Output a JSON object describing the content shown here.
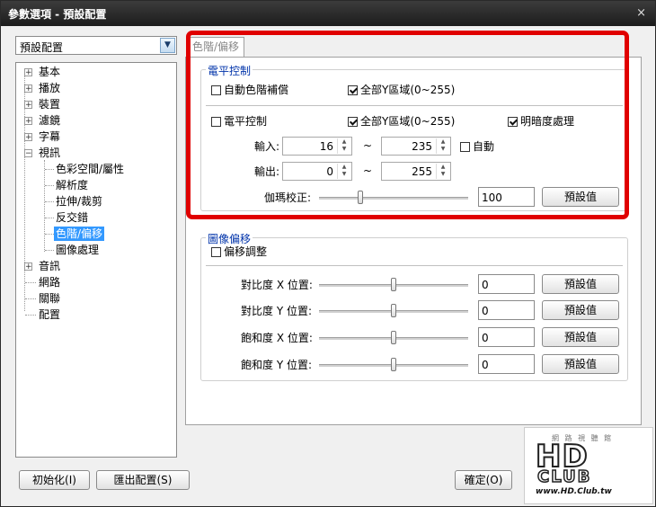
{
  "window": {
    "title": "參數選項 - 預設配置",
    "close_glyph": "×"
  },
  "profile_select": {
    "value": "預設配置"
  },
  "tree": {
    "items": [
      {
        "label": "基本",
        "expander": "+"
      },
      {
        "label": "播放",
        "expander": "+"
      },
      {
        "label": "裝置",
        "expander": "+"
      },
      {
        "label": "濾鏡",
        "expander": "+"
      },
      {
        "label": "字幕",
        "expander": "+"
      },
      {
        "label": "視訊",
        "expander": "−"
      },
      {
        "label": "色彩空間/屬性"
      },
      {
        "label": "解析度"
      },
      {
        "label": "拉伸/裁剪"
      },
      {
        "label": "反交錯"
      },
      {
        "label": "色階/偏移",
        "selected": true
      },
      {
        "label": "圖像處理"
      },
      {
        "label": "音訊",
        "expander": "+"
      },
      {
        "label": "網路"
      },
      {
        "label": "關聯"
      },
      {
        "label": "配置"
      }
    ]
  },
  "tab": {
    "label": "色階/偏移"
  },
  "level_group": {
    "title": "電平控制",
    "auto_level": {
      "label": "自動色階補償",
      "checked": false
    },
    "full_range_1": {
      "label": "全部Y區域(0~255)",
      "checked": true
    },
    "level_control": {
      "label": "電平控制",
      "checked": false
    },
    "full_range_2": {
      "label": "全部Y區域(0~255)",
      "checked": true
    },
    "brightness": {
      "label": "明暗度處理",
      "checked": true
    },
    "input": {
      "label": "輸入:",
      "low": "16",
      "high": "235",
      "tilde": "~"
    },
    "auto": {
      "label": "自動",
      "checked": false
    },
    "output": {
      "label": "輸出:",
      "low": "0",
      "high": "255",
      "tilde": "~"
    },
    "gamma": {
      "label": "伽瑪校正:",
      "value": "100",
      "slider_fraction": 0.27,
      "reset": "預設值"
    }
  },
  "offset_group": {
    "title": "圖像偏移",
    "offset_adjust": {
      "label": "偏移調整",
      "checked": false
    },
    "rows": [
      {
        "label": "對比度 X 位置:",
        "value": "0",
        "reset": "預設值",
        "slider_fraction": 0.5
      },
      {
        "label": "對比度 Y 位置:",
        "value": "0",
        "reset": "預設值",
        "slider_fraction": 0.5
      },
      {
        "label": "飽和度 X 位置:",
        "value": "0",
        "reset": "預設值",
        "slider_fraction": 0.5
      },
      {
        "label": "飽和度 Y 位置:",
        "value": "0",
        "reset": "預設值",
        "slider_fraction": 0.5
      }
    ]
  },
  "footer": {
    "init_button": "初始化(I)",
    "export_button": "匯出配置(S)",
    "ok_button": "確定(O)"
  },
  "watermark": {
    "tiny": "網 路 視 聽 館",
    "big": "HD",
    "sub": "CLUB",
    "url": "www.HD.Club.tw"
  },
  "colors": {
    "highlight": "#e00000",
    "selection": "#3399ff",
    "group_title": "#0033aa"
  }
}
